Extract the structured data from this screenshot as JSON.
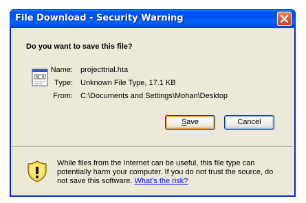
{
  "window": {
    "title": "File Download - Security Warning"
  },
  "dialog": {
    "question": "Do you want to save this file?",
    "fields": [
      {
        "label": "Name:",
        "value": "projecttrial.hta"
      },
      {
        "label": "Type:",
        "value": "Unknown File Type, 17.1 KB"
      },
      {
        "label": "From:",
        "value": "C:\\Documents and Settings\\Mohan\\Desktop"
      }
    ],
    "buttons": {
      "save_mnemonic": "S",
      "save_rest": "ave",
      "cancel": "Cancel"
    },
    "warning": {
      "text": "While files from the Internet can be useful, this file type can potentially harm your computer. If you do not trust the source, do not save this software.",
      "link": "What's the risk?"
    }
  },
  "icons": {
    "close": "close-icon",
    "file": "file-icon",
    "warning": "shield-warning-icon"
  },
  "colors": {
    "titlebar": "#0054E3",
    "dialog_bg": "#ECE9D8",
    "link": "#0000FF",
    "shield": "#F5D33A"
  }
}
